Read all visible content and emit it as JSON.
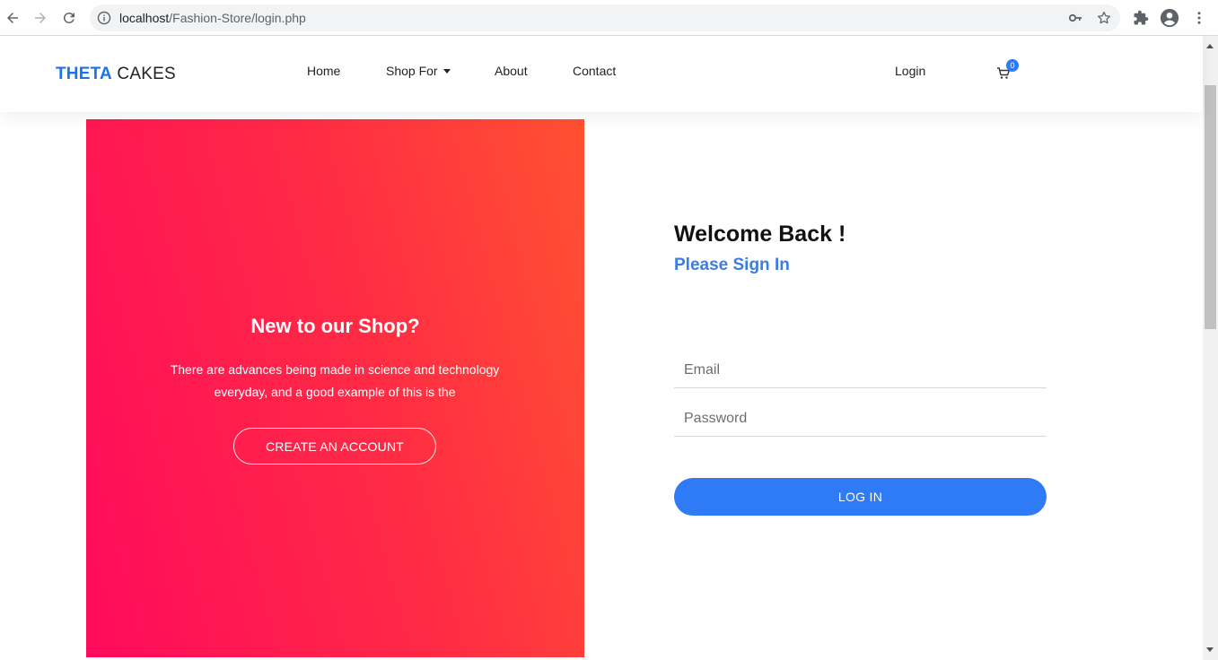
{
  "browser": {
    "url_host": "localhost",
    "url_path": "/Fashion-Store/login.php"
  },
  "header": {
    "brand_strong": "THETA",
    "brand_rest": " CAKES",
    "nav": {
      "home": "Home",
      "shop_for": "Shop For",
      "about": "About",
      "contact": "Contact"
    },
    "login": "Login",
    "cart_count": "0"
  },
  "promo": {
    "title": "New to our Shop?",
    "text": "There are advances being made in science and technology everyday, and a good example of this is the",
    "button": "CREATE AN ACCOUNT",
    "gradient_colors": [
      "#ff0a5c",
      "#ff5131"
    ]
  },
  "login_form": {
    "title": "Welcome Back !",
    "subtitle": "Please Sign In",
    "email_placeholder": "Email",
    "password_placeholder": "Password",
    "submit": "LOG IN"
  },
  "colors": {
    "accent": "#2f7af5",
    "brand": "#1a73e8"
  }
}
